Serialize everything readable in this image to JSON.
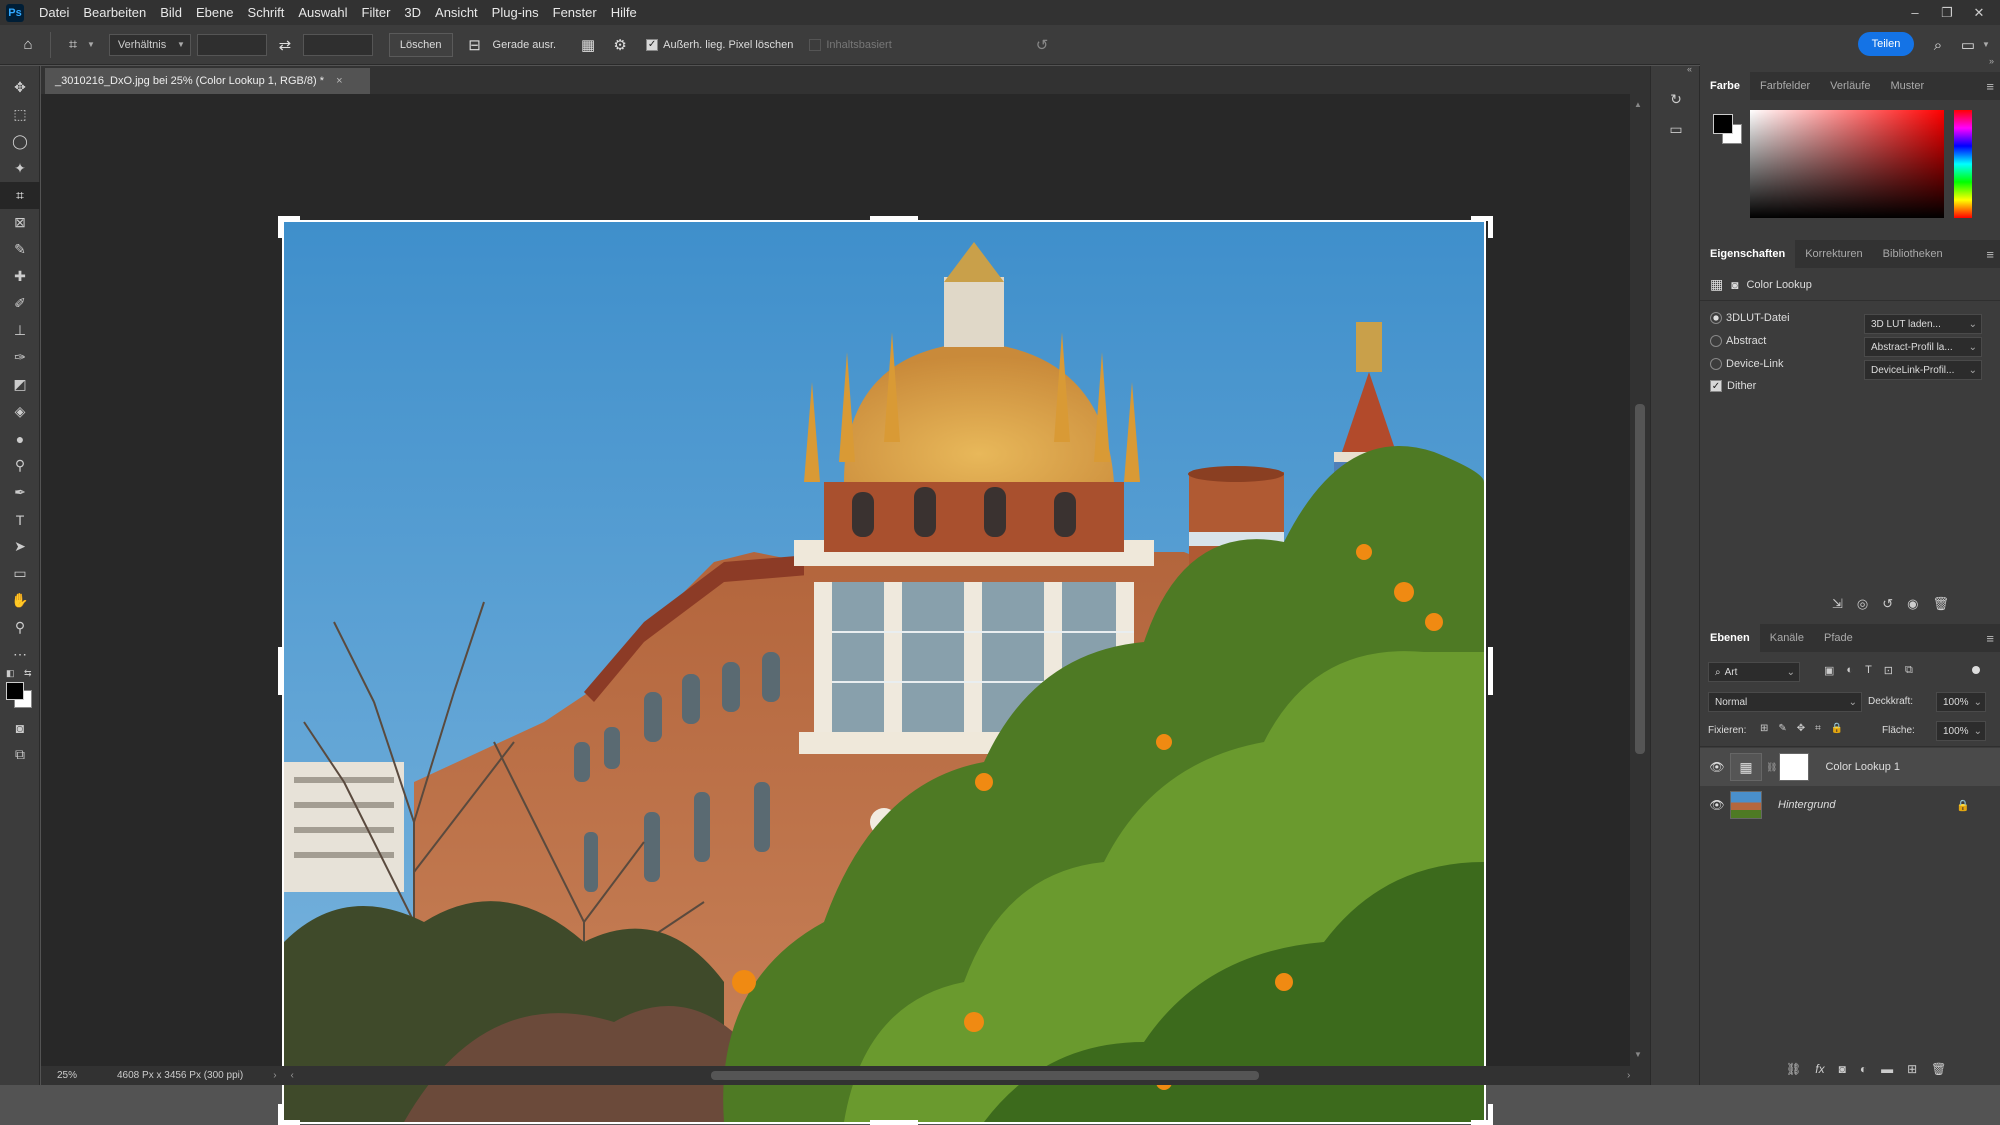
{
  "menubar": {
    "logo": "Ps",
    "items": [
      "Datei",
      "Bearbeiten",
      "Bild",
      "Ebene",
      "Schrift",
      "Auswahl",
      "Filter",
      "3D",
      "Ansicht",
      "Plug-ins",
      "Fenster",
      "Hilfe"
    ],
    "window_controls": [
      "–",
      "❐",
      "✕"
    ]
  },
  "options": {
    "ratio_select": "Verhältnis",
    "delete_button": "Löschen",
    "straighten_label": "Gerade ausr.",
    "delete_cropped_label": "Außerh. lieg. Pixel löschen",
    "content_aware_label": "Inhaltsbasiert",
    "share_button": "Teilen"
  },
  "document": {
    "tab_title": "_3010216_DxO.jpg bei 25% (Color Lookup 1, RGB/8) *",
    "tab_close": "×",
    "zoom": "25%",
    "info": "4608 Px x 3456 Px (300 ppi)"
  },
  "color_panel": {
    "tabs": [
      "Farbe",
      "Farbfelder",
      "Verläufe",
      "Muster"
    ],
    "active_tab": "Farbe",
    "foreground": "#000000",
    "background": "#ffffff",
    "hue": "#ff0000"
  },
  "properties_panel": {
    "tabs": [
      "Eigenschaften",
      "Korrekturen",
      "Bibliotheken"
    ],
    "active_tab": "Eigenschaften",
    "adjustment_name": "Color Lookup",
    "rows": [
      {
        "label": "3DLUT-Datei",
        "selected": true,
        "dropdown": "3D LUT laden..."
      },
      {
        "label": "Abstract",
        "selected": false,
        "dropdown": "Abstract-Profil la..."
      },
      {
        "label": "Device-Link",
        "selected": false,
        "dropdown": "DeviceLink-Profil..."
      }
    ],
    "dither_label": "Dither",
    "dither_checked": true
  },
  "layers_panel": {
    "tabs": [
      "Ebenen",
      "Kanäle",
      "Pfade"
    ],
    "active_tab": "Ebenen",
    "filter_select": "Art",
    "blend_mode": "Normal",
    "opacity_label": "Deckkraft:",
    "opacity_value": "100%",
    "lock_label": "Fixieren:",
    "fill_label": "Fläche:",
    "fill_value": "100%",
    "layers": [
      {
        "name": "Color Lookup 1",
        "selected": true
      },
      {
        "name": "Hintergrund",
        "selected": false
      }
    ]
  }
}
